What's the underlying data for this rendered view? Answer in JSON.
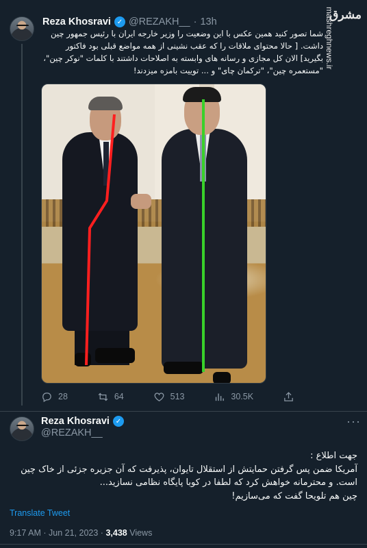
{
  "tweet1": {
    "author_name": "Reza Khosravi",
    "handle": "@REZAKH__",
    "separator": "·",
    "time": "13h",
    "more_icon": "more-icon",
    "text": "شما تصور کنید همین عکس با این وضعیت را وزیر خارجه ایران با رئیس جمهور چین داشت. [ حالا محتوای ملاقات را که عقب نشینی از همه مواضع قبلی بود فاکتور بگیرید] الان کل مجازی و رسانه های وابسته به اصلاحات داشتند با کلمات \"نوکر چین\"، \"مستعمره چین\"، \"ترکمان چای\" و ... توییت بامزه میزدند!",
    "actions": {
      "replies": "28",
      "retweets": "64",
      "likes": "513",
      "views": "30.5K"
    },
    "image_overlay_colors": {
      "left_line": "#ff1f1f",
      "right_line": "#39d12a"
    }
  },
  "watermark": {
    "logo_text": "مشرق",
    "url": "mashreghnews.ir"
  },
  "tweet2": {
    "author_name": "Reza Khosravi",
    "handle": "@REZAKH__",
    "lines": [
      "جهت اطلاع :",
      "آمریکا ضمن پس گرفتن حمایتش از استقلال تایوان، پذیرفت که آن جزیره جزئی از خاک چین است. و محترمانه خواهش کرد که لطفا در کوبا پایگاه نظامی نسازید...",
      "چین هم تلویحا گفت که می‌سازیم!"
    ],
    "translate_label": "Translate Tweet",
    "time": "9:17 AM",
    "separator": "·",
    "date": "Jun 21, 2023",
    "views_count": "3,438",
    "views_label": "Views"
  },
  "colors": {
    "background": "#15202b",
    "accent": "#1d9bf0",
    "muted": "#8b98a5",
    "text": "#f7f9f9"
  }
}
